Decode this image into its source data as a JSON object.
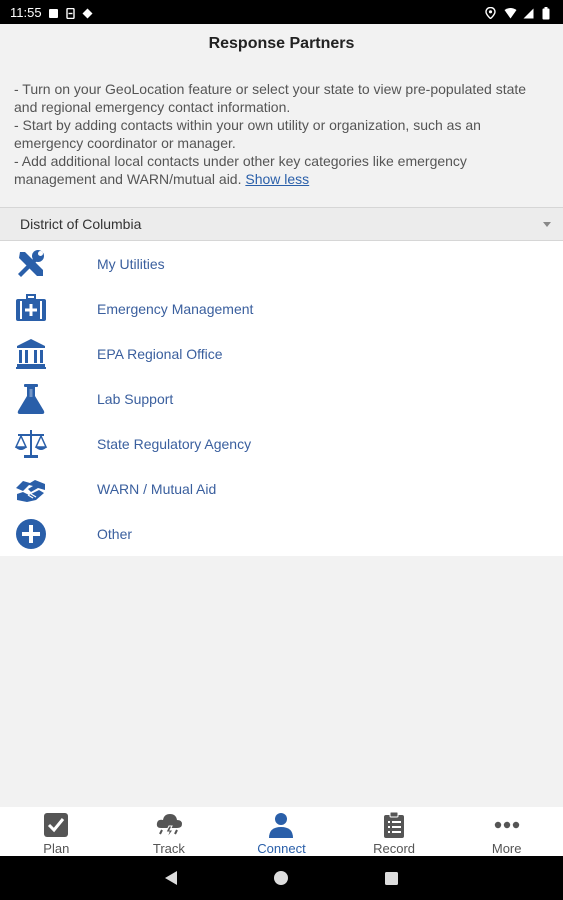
{
  "status_bar": {
    "time": "11:55"
  },
  "header": {
    "title": "Response Partners"
  },
  "intro": {
    "line1": "- Turn on your GeoLocation feature or select your state to view pre-populated state and regional emergency contact information.",
    "line2": "- Start by adding contacts within your own utility or organization, such as an emergency coordinator or manager.",
    "line3": "- Add additional local contacts under other key categories like emergency management and WARN/mutual aid.",
    "show_less": "Show less"
  },
  "state_select": {
    "value": "District of Columbia"
  },
  "categories": [
    {
      "label": "My Utilities",
      "icon": "tools-icon"
    },
    {
      "label": "Emergency Management",
      "icon": "medical-kit-icon"
    },
    {
      "label": "EPA Regional Office",
      "icon": "government-building-icon"
    },
    {
      "label": "Lab Support",
      "icon": "flask-icon"
    },
    {
      "label": "State Regulatory Agency",
      "icon": "balance-scale-icon"
    },
    {
      "label": "WARN / Mutual Aid",
      "icon": "handshake-icon"
    },
    {
      "label": "Other",
      "icon": "plus-circle-icon"
    }
  ],
  "bottom_nav": [
    {
      "label": "Plan",
      "icon": "checkbox-icon"
    },
    {
      "label": "Track",
      "icon": "storm-cloud-icon"
    },
    {
      "label": "Connect",
      "icon": "person-icon",
      "active": true
    },
    {
      "label": "Record",
      "icon": "clipboard-icon"
    },
    {
      "label": "More",
      "icon": "more-dots-icon"
    }
  ],
  "colors": {
    "accent": "#2a5fa9",
    "icon_blue": "#2a5fa9",
    "text_link": "#3a5f9e"
  }
}
